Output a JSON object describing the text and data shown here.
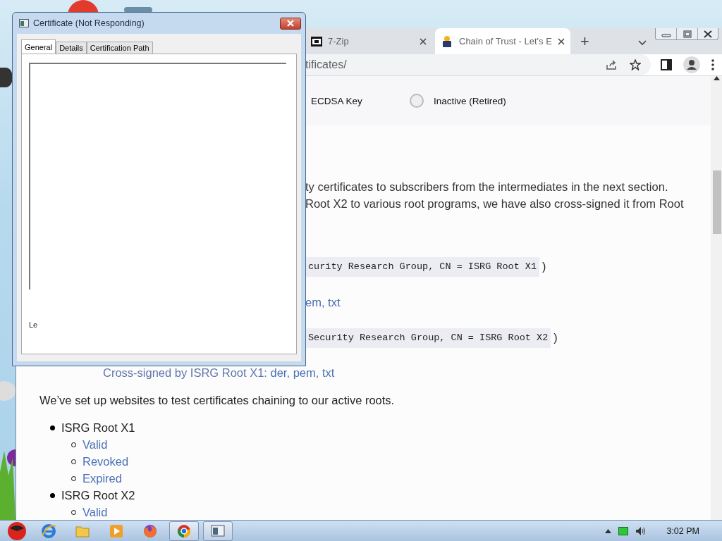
{
  "browser": {
    "tabs": [
      {
        "label": "7-Zip",
        "kind": "archive",
        "selected": false
      },
      {
        "label": "Chain of Trust - Let's E",
        "kind": "site",
        "selected": true
      }
    ],
    "new_tab": "+",
    "address": "tificates/",
    "content": {
      "key_row": {
        "cells": [
          "ECDSA Key"
        ],
        "status": {
          "label": "Inactive (Retired)",
          "active": false
        }
      },
      "intro_lines": [
        "ty certificates to subscribers from the intermediates in the next section.",
        "Root X2 to various root programs, we have also cross-signed it from Root"
      ],
      "roots": [
        {
          "code": "curity Research Group, CN = ISRG Root X1",
          "after": ")",
          "parts": [
            {
              "kind": "link",
              "text": "em"
            },
            {
              "kind": "text",
              "text": ", "
            },
            {
              "kind": "link",
              "text": "txt"
            }
          ]
        },
        {
          "code": "Security Research Group, CN = ISRG Root X2",
          "after": ")",
          "parts": [
            {
              "kind": "text",
              "text": "Cross-signed by ISRG Root X1: "
            },
            {
              "kind": "link",
              "text": "der"
            },
            {
              "kind": "text",
              "text": ", "
            },
            {
              "kind": "link",
              "text": "pem"
            },
            {
              "kind": "text",
              "text": ", "
            },
            {
              "kind": "link",
              "text": "txt"
            }
          ]
        }
      ],
      "tests_intro": "We’ve set up websites to test certificates chaining to our active roots.",
      "tests": [
        {
          "label": "ISRG Root X1",
          "children": [
            {
              "label": "Valid"
            },
            {
              "label": "Revoked"
            },
            {
              "label": "Expired"
            }
          ]
        },
        {
          "label": "ISRG Root X2",
          "children": [
            {
              "label": "Valid"
            }
          ]
        }
      ]
    }
  },
  "dialog": {
    "title": "Certificate (Not Responding)",
    "tabs": [
      {
        "label": "General",
        "selected": true
      },
      {
        "label": "Details",
        "selected": false
      },
      {
        "label": "Certification Path",
        "selected": false
      }
    ],
    "fragment": "Le"
  },
  "taskbar": {
    "apps": [
      {
        "kind": "ie",
        "active": false
      },
      {
        "kind": "folder",
        "active": false
      },
      {
        "kind": "media",
        "active": false
      },
      {
        "kind": "firefox",
        "active": false
      },
      {
        "kind": "chrome",
        "active": true
      },
      {
        "kind": "window",
        "active": true
      }
    ],
    "time": "3:02 PM"
  }
}
